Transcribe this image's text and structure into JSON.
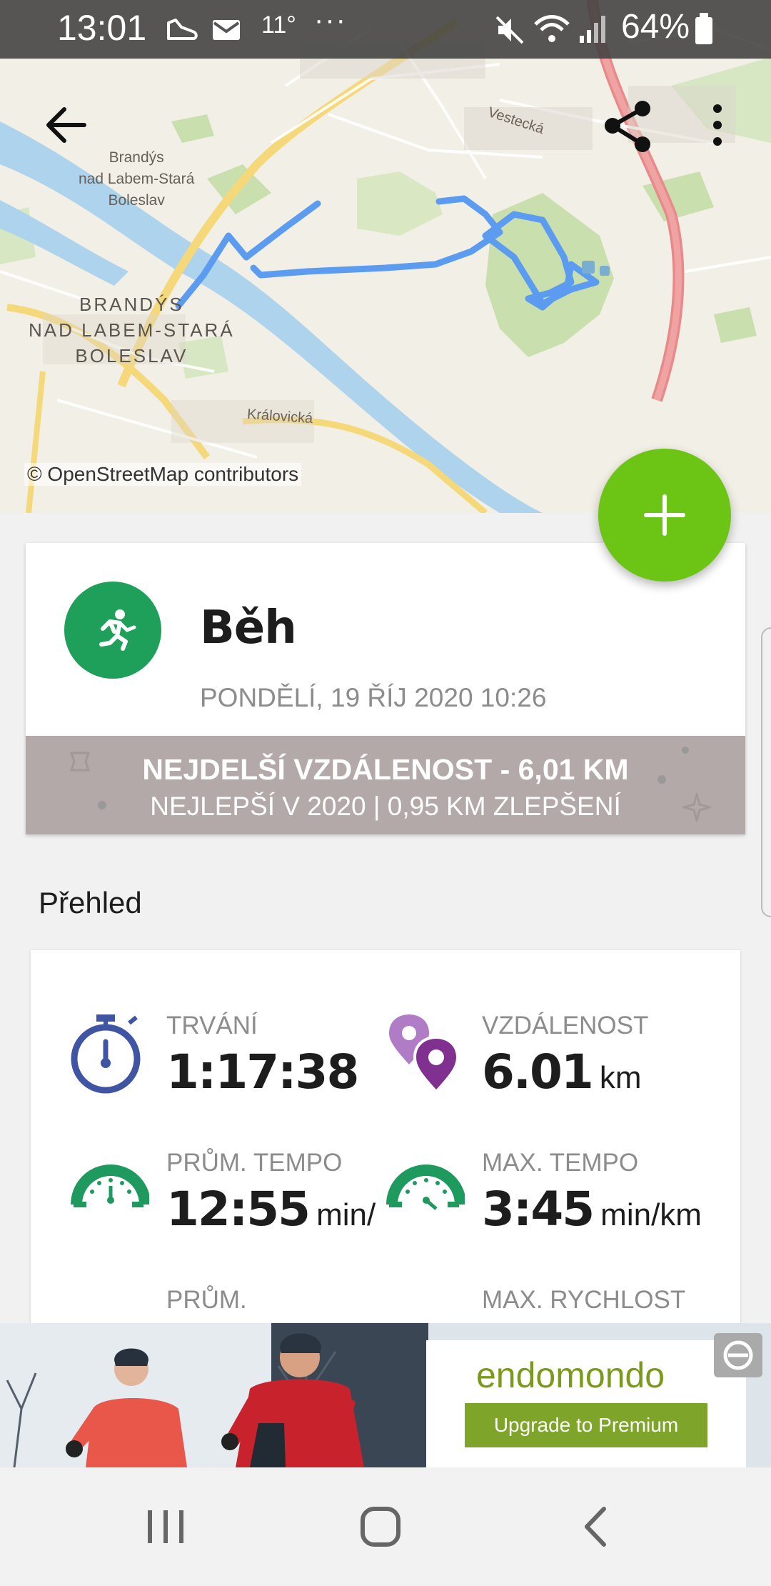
{
  "status_bar": {
    "time": "13:01",
    "temperature": "11°",
    "more": "···",
    "battery_percent": "64%",
    "icons": [
      "shoe-icon",
      "mail-icon",
      "mute-icon",
      "wifi-icon",
      "signal-icon",
      "battery-icon"
    ]
  },
  "map": {
    "attribution": "© OpenStreetMap contributors",
    "labels": {
      "town_small": "Brandýs\nnad Labem-Stará\nBoleslav",
      "town_large": "BRANDÝS\nNAD LABEM-STARÁ\nBOLESLAV",
      "street_vestecka": "Vestecká",
      "street_kralovicka": "Královická",
      "top_label": "Stará Boleslav"
    },
    "route_color": "#5b9cf0"
  },
  "toolbar": {
    "back_icon": "arrow-back-icon",
    "share_icon": "share-icon",
    "menu_icon": "more-vertical-icon"
  },
  "fab": {
    "icon": "plus-icon",
    "color": "#6cc415"
  },
  "workout": {
    "sport": "Běh",
    "date": "PONDĚLÍ, 19 ŘÍJ 2020 10:26",
    "sport_icon": "running-icon",
    "sport_color": "#1fa05a",
    "achievement": {
      "line1": "NEJDELŠÍ VZDÁLENOST  -  6,01 KM",
      "line2": "NEJLEPŠÍ V 2020  |  0,95 KM ZLEPŠENÍ"
    }
  },
  "overview": {
    "title": "Přehled",
    "stats": [
      {
        "label": "TRVÁNÍ",
        "value": "1:17:38",
        "unit": "",
        "icon": "stopwatch-icon"
      },
      {
        "label": "VZDÁLENOST",
        "value": "6.01",
        "unit": "km",
        "icon": "map-pins-icon"
      },
      {
        "label": "PRŮM. TEMPO",
        "value": "12:55",
        "unit": "min/",
        "icon": "speedometer-green-icon"
      },
      {
        "label": "MAX. TEMPO",
        "value": "3:45",
        "unit": "min/km",
        "icon": "speedometer-green-icon"
      },
      {
        "label": "PRŮM.",
        "value": "",
        "unit": "",
        "icon": "speedometer-orange-icon"
      },
      {
        "label": "MAX. RYCHLOST",
        "value": "",
        "unit": "",
        "icon": "speedometer-orange-icon"
      }
    ]
  },
  "ad": {
    "brand": "endomondo",
    "cta": "Upgrade to Premium",
    "brand_color": "#7a9a1a"
  },
  "nav_bar": {
    "recents_icon": "recents-icon",
    "home_icon": "home-icon",
    "back_icon": "nav-back-icon"
  }
}
